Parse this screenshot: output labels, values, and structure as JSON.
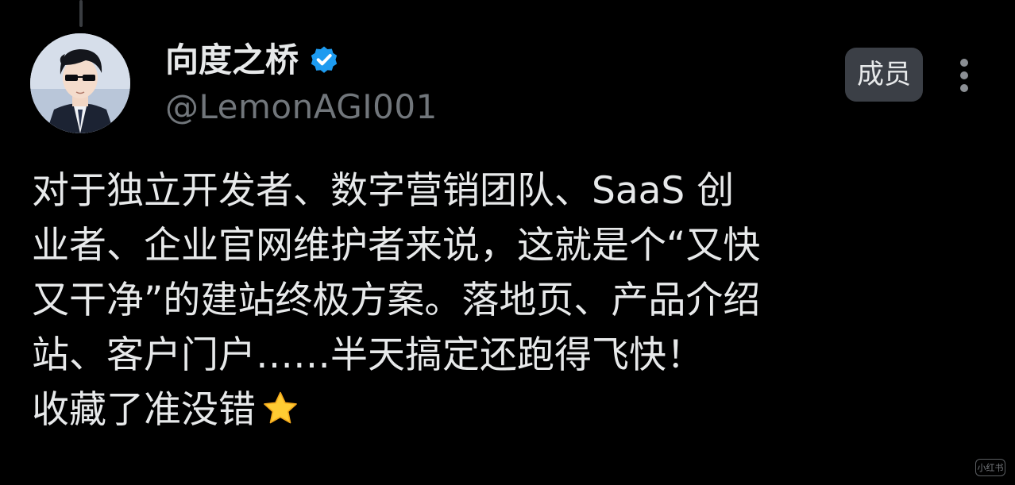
{
  "post": {
    "display_name": "向度之桥",
    "verified_icon": "verified-badge-icon",
    "handle": "@LemonAGI001",
    "member_badge": "成员",
    "more_icon": "more-vertical-icon",
    "body_lines": [
      "对于独立开发者、数字营销团队、SaaS 创",
      "业者、企业官网维护者来说，这就是个“又快",
      "又干净”的建站终极方案。落地页、产品介绍",
      "站、客户门户……半天搞定还跑得飞快！",
      "收藏了准没错"
    ],
    "trailing_emoji": "star-emoji"
  },
  "watermark": {
    "text": "小红书"
  },
  "colors": {
    "background": "#000000",
    "text_primary": "#e7e9ea",
    "text_secondary": "#71767b",
    "verified_blue": "#1d9bf0",
    "badge_bg": "#3b3f46",
    "star_yellow": "#ffcc33"
  }
}
